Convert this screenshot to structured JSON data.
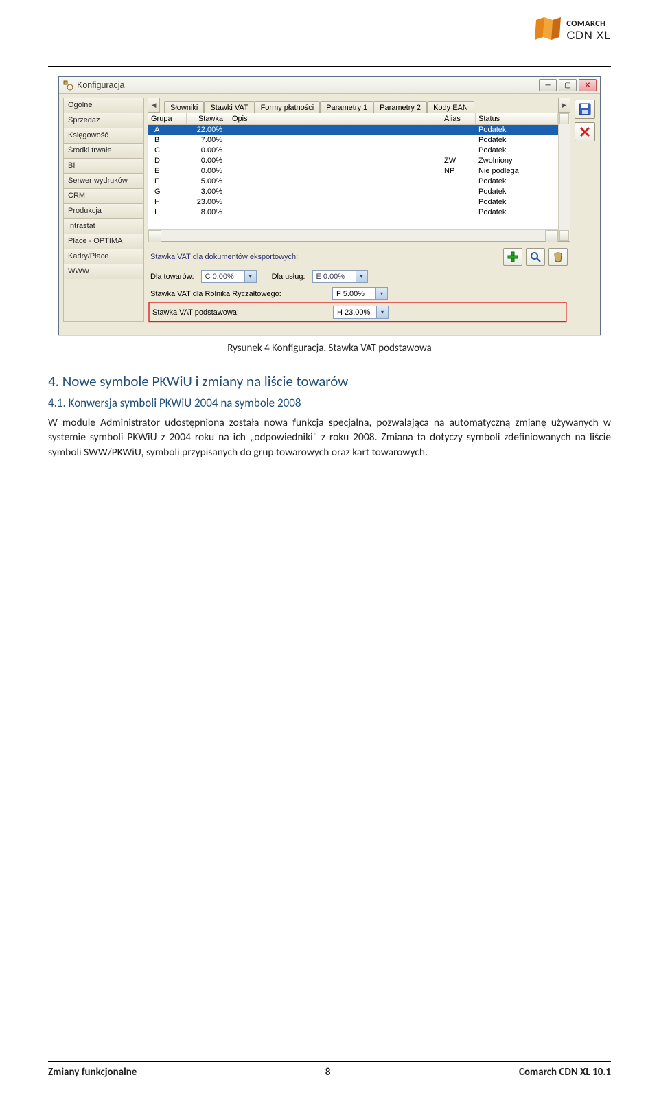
{
  "brand": {
    "top": "COMARCH",
    "sub": "CDN XL"
  },
  "window": {
    "title": "Konfiguracja",
    "sidebar": [
      "Ogólne",
      "Sprzedaż",
      "Księgowość",
      "Środki trwałe",
      "BI",
      "Serwer wydruków",
      "CRM",
      "Produkcja",
      "Intrastat",
      "Płace - OPTIMA",
      "Kadry/Płace",
      "WWW"
    ],
    "tabs": [
      "Słowniki",
      "Stawki VAT",
      "Formy płatności",
      "Parametry 1",
      "Parametry 2",
      "Kody EAN"
    ],
    "active_tab": 1,
    "grid": {
      "headers": {
        "grupa": "Grupa",
        "stawka": "Stawka",
        "opis": "Opis",
        "alias": "Alias",
        "status": "Status"
      },
      "rows": [
        {
          "grupa": "A",
          "stawka": "22.00%",
          "opis": "",
          "alias": "",
          "status": "Podatek",
          "selected": true
        },
        {
          "grupa": "B",
          "stawka": "7.00%",
          "opis": "",
          "alias": "",
          "status": "Podatek"
        },
        {
          "grupa": "C",
          "stawka": "0.00%",
          "opis": "",
          "alias": "",
          "status": "Podatek"
        },
        {
          "grupa": "D",
          "stawka": "0.00%",
          "opis": "",
          "alias": "ZW",
          "status": "Zwolniony"
        },
        {
          "grupa": "E",
          "stawka": "0.00%",
          "opis": "",
          "alias": "NP",
          "status": "Nie podlega"
        },
        {
          "grupa": "F",
          "stawka": "5.00%",
          "opis": "",
          "alias": "",
          "status": "Podatek"
        },
        {
          "grupa": "G",
          "stawka": "3.00%",
          "opis": "",
          "alias": "",
          "status": "Podatek"
        },
        {
          "grupa": "H",
          "stawka": "23.00%",
          "opis": "",
          "alias": "",
          "status": "Podatek"
        },
        {
          "grupa": "I",
          "stawka": "8.00%",
          "opis": "",
          "alias": "",
          "status": "Podatek"
        }
      ]
    },
    "export": {
      "heading": "Stawka VAT dla dokumentów eksportowych:",
      "goods_label": "Dla towarów:",
      "goods_value": "C 0.00%",
      "services_label": "Dla usług:",
      "services_value": "E 0.00%",
      "rolnik_label": "Stawka VAT dla Rolnika Ryczałtowego:",
      "rolnik_value": "F 5.00%",
      "podst_label": "Stawka VAT podstawowa:",
      "podst_value": "H 23.00%"
    }
  },
  "caption": "Rysunek 4 Konfiguracja, Stawka VAT podstawowa",
  "section": {
    "num": "4.",
    "title": "Nowe symbole PKWiU i zmiany na liście towarów"
  },
  "subsection": {
    "num": "4.1.",
    "title": "Konwersja symboli PKWiU 2004 na symbole 2008"
  },
  "paragraph": "W module Administrator udostępniona została nowa funkcja specjalna, pozwalająca na automatyczną zmianę używanych w systemie symboli PKWiU z 2004 roku na ich „odpowiedniki\" z roku 2008. Zmiana ta dotyczy symboli zdefiniowanych na liście symboli SWW/PKWiU, symboli przypisanych do grup towarowych oraz kart towarowych.",
  "footer": {
    "left": "Zmiany funkcjonalne",
    "center": "8",
    "right": "Comarch CDN XL 10.1"
  }
}
